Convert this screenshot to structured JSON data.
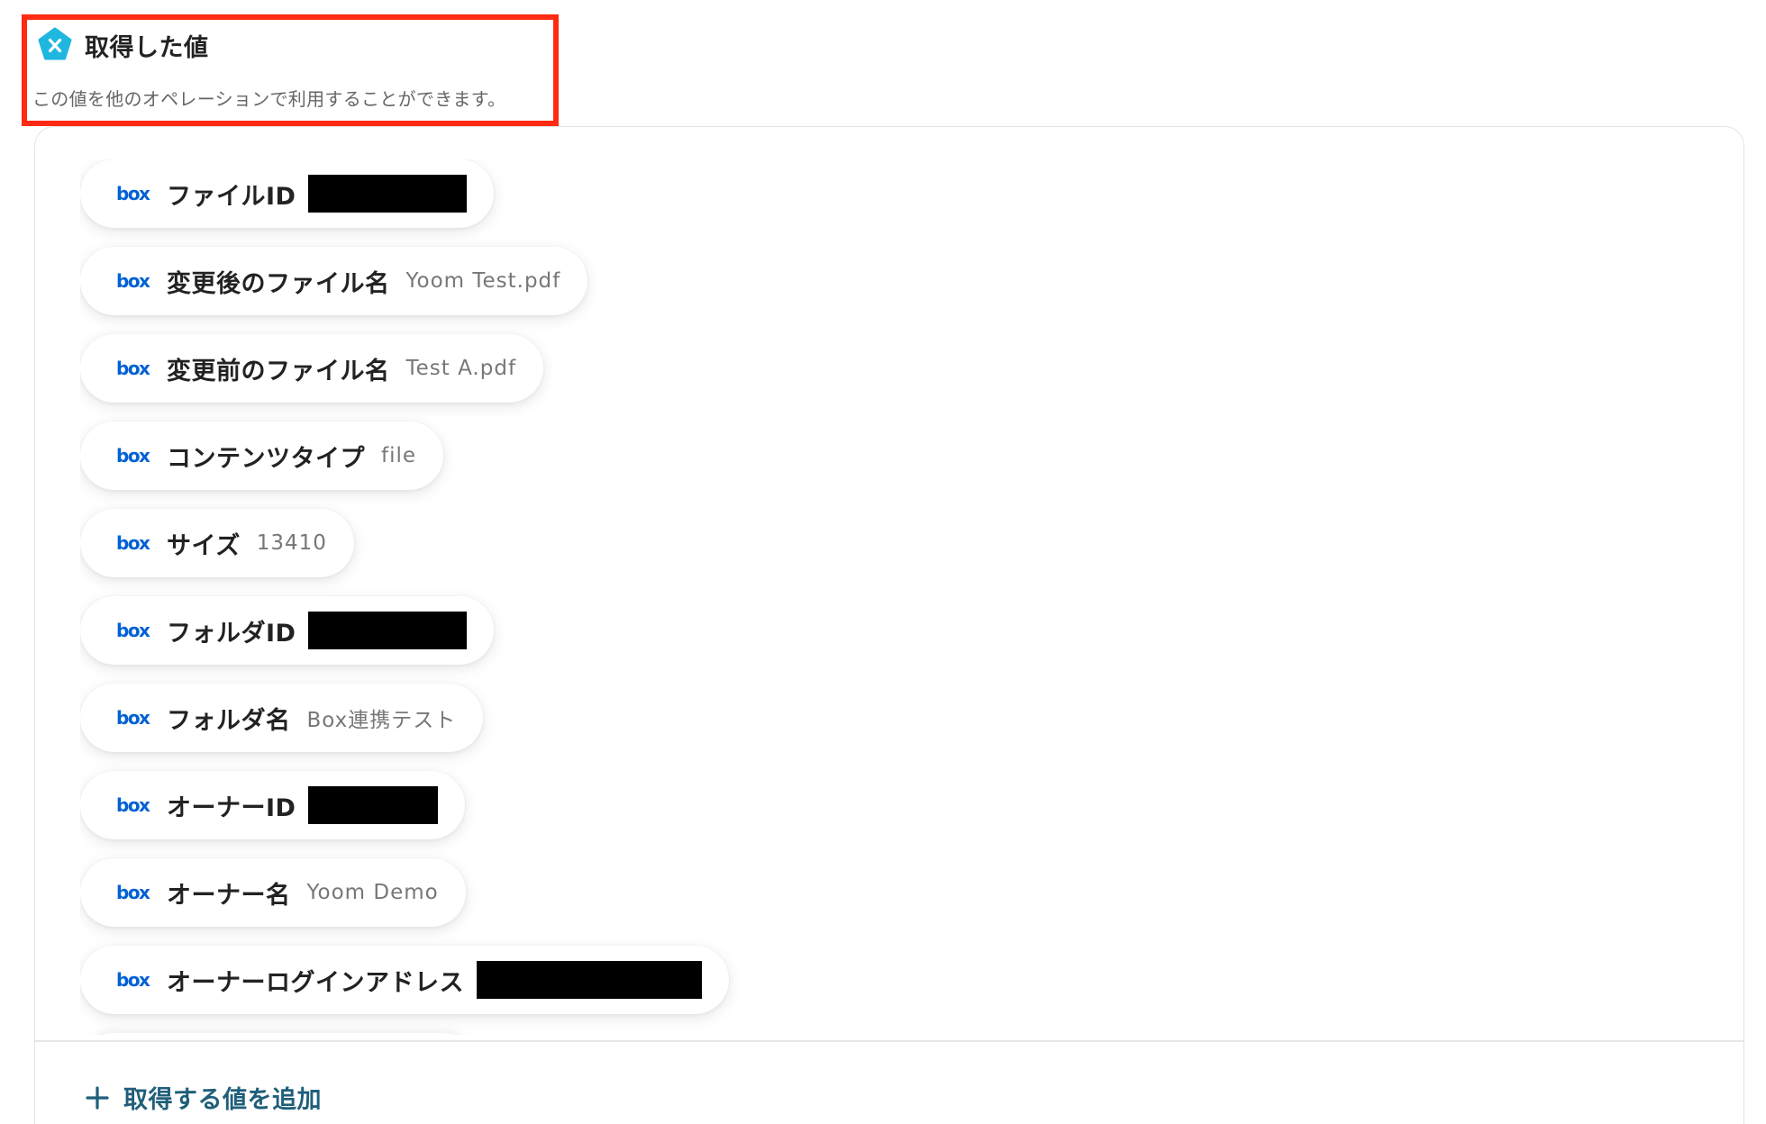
{
  "header": {
    "title": "取得した値",
    "description": "この値を他のオペレーションで利用することができます。"
  },
  "colors": {
    "highlight_border": "#ff2a12",
    "yoom_icon": "#1fb7e0",
    "box_brand": "#0061d5",
    "add_text": "#1f5f7a"
  },
  "values": [
    {
      "label": "ファイルID",
      "value": "",
      "redacted": true,
      "icon": "box-logo"
    },
    {
      "label": "変更後のファイル名",
      "value": "Yoom Test.pdf",
      "redacted": false,
      "icon": "box-logo"
    },
    {
      "label": "変更前のファイル名",
      "value": "Test A.pdf",
      "redacted": false,
      "icon": "box-logo"
    },
    {
      "label": "コンテンツタイプ",
      "value": "file",
      "redacted": false,
      "icon": "box-logo"
    },
    {
      "label": "サイズ",
      "value": "13410",
      "redacted": false,
      "icon": "box-logo"
    },
    {
      "label": "フォルダID",
      "value": "",
      "redacted": true,
      "icon": "box-logo"
    },
    {
      "label": "フォルダ名",
      "value": "Box連携テスト",
      "redacted": false,
      "icon": "box-logo"
    },
    {
      "label": "オーナーID",
      "value": "",
      "redacted": true,
      "icon": "box-logo"
    },
    {
      "label": "オーナー名",
      "value": "Yoom Demo",
      "redacted": false,
      "icon": "box-logo"
    },
    {
      "label": "オーナーログインアドレス",
      "value": "",
      "redacted": true,
      "icon": "box-logo"
    }
  ],
  "footer": {
    "add_label": "取得する値を追加",
    "icon": "plus-icon"
  }
}
